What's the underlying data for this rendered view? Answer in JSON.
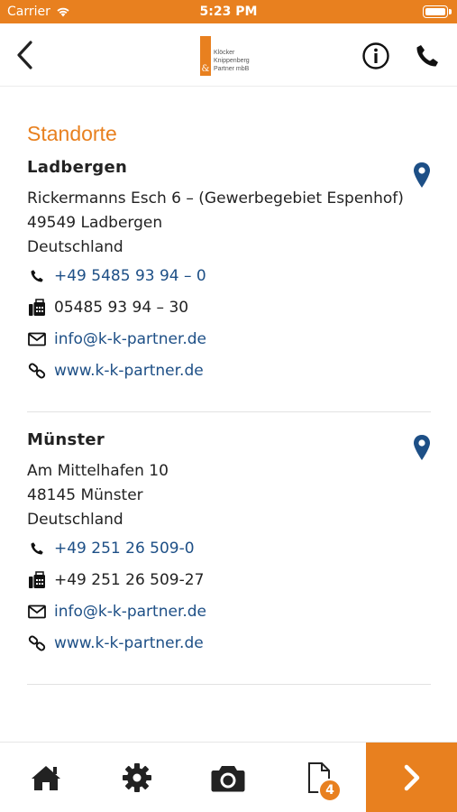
{
  "status_bar": {
    "carrier": "Carrier",
    "time": "5:23 PM",
    "battery_level": 1.0
  },
  "nav": {
    "back_icon": "chevron-left-icon",
    "logo": {
      "mark_glyph": "&",
      "lines": [
        "Klöcker",
        "Knippenberg",
        "Partner mbB"
      ]
    },
    "info_icon": "info-circle-icon",
    "phone_icon": "phone-icon"
  },
  "page": {
    "title": "Standorte",
    "locations": [
      {
        "name": "Ladbergen",
        "address": [
          "Rickermanns Esch 6 – (Gewerbegebiet Espenhof)",
          "49549 Ladbergen",
          "Deutschland"
        ],
        "phone": "+49 5485 93 94 – 0",
        "fax": "05485 93 94 – 30",
        "email": "info@k-k-partner.de",
        "web": "www.k-k-partner.de"
      },
      {
        "name": "Münster",
        "address": [
          "Am Mittelhafen 10",
          "48145 Münster",
          "Deutschland"
        ],
        "phone": "+49 251 26 509-0",
        "fax": "+49 251 26 509-27",
        "email": "info@k-k-partner.de",
        "web": "www.k-k-partner.de"
      }
    ]
  },
  "tab_bar": {
    "items": [
      "home-icon",
      "gear-icon",
      "camera-icon",
      "document-icon",
      "chevron-right-icon"
    ],
    "docs_badge": "4"
  },
  "colors": {
    "accent": "#e8801f",
    "link": "#1d4f86",
    "pin": "#1d4f86"
  }
}
